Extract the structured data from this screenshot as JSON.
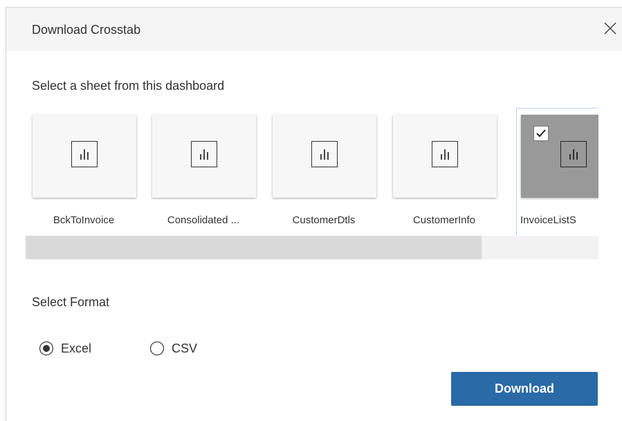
{
  "dialog": {
    "title": "Download Crosstab",
    "close_icon": "close-icon"
  },
  "sheet_section": {
    "label": "Select a sheet from this dashboard",
    "sheets": [
      {
        "label": "BckToInvoice",
        "selected": false,
        "icon": "bar-chart-icon"
      },
      {
        "label": "Consolidated ...",
        "selected": false,
        "icon": "bar-chart-icon"
      },
      {
        "label": "CustomerDtls",
        "selected": false,
        "icon": "bar-chart-icon"
      },
      {
        "label": "CustomerInfo",
        "selected": false,
        "icon": "bar-chart-icon"
      },
      {
        "label": "InvoiceListS",
        "selected": true,
        "icon": "bar-chart-icon"
      }
    ],
    "scroll_position": 0.8
  },
  "format_section": {
    "label": "Select Format",
    "options": [
      {
        "label": "Excel",
        "checked": true
      },
      {
        "label": "CSV",
        "checked": false
      }
    ]
  },
  "footer": {
    "download_label": "Download"
  },
  "colors": {
    "primary_button": "#2a6aa6",
    "header_bg": "#f5f5f5",
    "selected_thumb": "#999999",
    "selected_border": "#b9d7f1"
  }
}
